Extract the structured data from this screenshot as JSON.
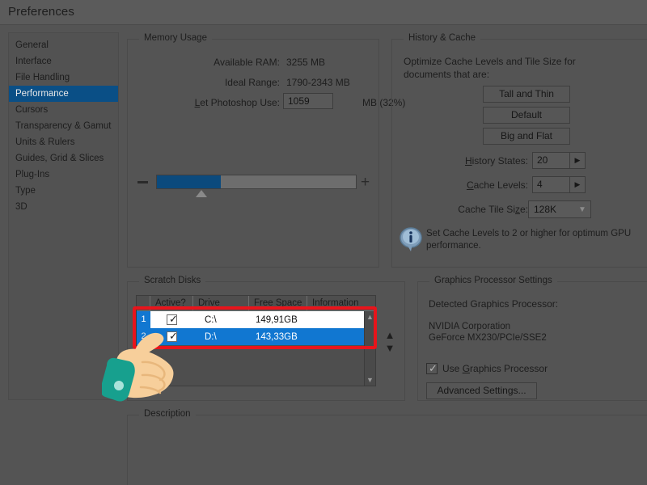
{
  "window": {
    "title": "Preferences"
  },
  "sidebar": {
    "items": [
      {
        "label": "General",
        "selected": false
      },
      {
        "label": "Interface",
        "selected": false
      },
      {
        "label": "File Handling",
        "selected": false
      },
      {
        "label": "Performance",
        "selected": true
      },
      {
        "label": "Cursors",
        "selected": false
      },
      {
        "label": "Transparency & Gamut",
        "selected": false
      },
      {
        "label": "Units & Rulers",
        "selected": false
      },
      {
        "label": "Guides, Grid & Slices",
        "selected": false
      },
      {
        "label": "Plug-Ins",
        "selected": false
      },
      {
        "label": "Type",
        "selected": false
      },
      {
        "label": "3D",
        "selected": false
      }
    ]
  },
  "memory": {
    "legend": "Memory Usage",
    "available_ram_label": "Available RAM:",
    "available_ram_value": "3255 MB",
    "ideal_range_label": "Ideal Range:",
    "ideal_range_value": "1790-2343 MB",
    "let_use_label": "Let Photoshop Use:",
    "let_use_value": "1059",
    "let_use_suffix": "MB (32%)",
    "slider_percent": 32,
    "minus_icon": "minus-icon",
    "plus_icon": "plus-icon"
  },
  "history": {
    "legend": "History & Cache",
    "description": "Optimize Cache Levels and Tile Size for documents that are:",
    "buttons": [
      {
        "label": "Tall and Thin"
      },
      {
        "label": "Default"
      },
      {
        "label": "Big and Flat"
      }
    ],
    "history_states_label": "History States:",
    "history_states_value": "20",
    "cache_levels_label": "Cache Levels:",
    "cache_levels_value": "4",
    "cache_tile_label": "Cache Tile Size:",
    "cache_tile_value": "128K",
    "note": "Set Cache Levels to 2 or higher for optimum GPU performance.",
    "note_icon": "info-icon",
    "spinner_arrow": "▶",
    "select_chevron": "chevron-down-icon"
  },
  "scratch": {
    "legend": "Scratch Disks",
    "columns": [
      "",
      "Active?",
      "Drive",
      "Free Space",
      "Information"
    ],
    "rows": [
      {
        "num": "1",
        "active": true,
        "drive": "C:\\",
        "free": "149,91GB",
        "info": "",
        "selected": false
      },
      {
        "num": "2",
        "active": true,
        "drive": "D:\\",
        "free": "143,33GB",
        "info": "",
        "selected": true
      }
    ],
    "scroll_up": "▲",
    "scroll_down": "▼",
    "reorder_up": "▲",
    "reorder_down": "▼",
    "highlight_color": "#e8141b",
    "selected_row_color": "#1177d1"
  },
  "gpu": {
    "legend": "Graphics Processor Settings",
    "detected_label": "Detected Graphics Processor:",
    "vendor": "NVIDIA Corporation",
    "model": "GeForce MX230/PCIe/SSE2",
    "use_gpu_label": "Use Graphics Processor",
    "use_gpu_checked": true,
    "advanced_button": "Advanced Settings..."
  },
  "description": {
    "legend": "Description",
    "text": ""
  },
  "annotation": {
    "hand_cursor": "pointing-hand-cursor",
    "sleeve_color": "#17a08e",
    "skin_color": "#f5c48d"
  },
  "theme": {
    "bg": "#545454",
    "accent_blue": "#0a4f86",
    "select_blue": "#1177d1",
    "text": "#1d1d1d"
  }
}
